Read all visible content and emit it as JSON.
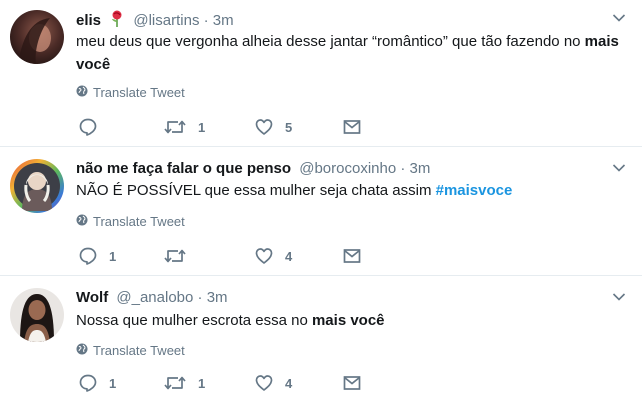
{
  "tweets": [
    {
      "name": "elis",
      "handle": "@lisartins",
      "separator": "·",
      "time": "3m",
      "text": {
        "t1": "meu deus que vergonha alheia desse jantar “romântico” que tão fazendo no ",
        "b1": "mais você"
      },
      "translate_label": "Translate Tweet",
      "replies": "",
      "retweets": "1",
      "likes": "5"
    },
    {
      "name": "não me faça falar o que penso",
      "handle": "@borocoxinho",
      "separator": "·",
      "time": "3m",
      "text": {
        "t1": "NÃO É POSSÍVEL que essa mulher seja chata assim ",
        "hashtag": "#maisvoce"
      },
      "translate_label": "Translate Tweet",
      "replies": "1",
      "retweets": "",
      "likes": "4"
    },
    {
      "name": "Wolf",
      "handle": "@_analobo",
      "separator": "·",
      "time": "3m",
      "text": {
        "t1": "Nossa que mulher escrota essa no ",
        "b1": "mais você"
      },
      "translate_label": "Translate Tweet",
      "replies": "1",
      "retweets": "1",
      "likes": "4"
    }
  ],
  "colors": {
    "text": "#14171a",
    "muted": "#657786",
    "link": "#1b95e0",
    "divider": "#e6ecf0"
  },
  "icons": [
    "rose-emoji-icon",
    "chevron-down-icon",
    "globe-icon",
    "reply-icon",
    "retweet-icon",
    "like-icon",
    "message-icon"
  ]
}
